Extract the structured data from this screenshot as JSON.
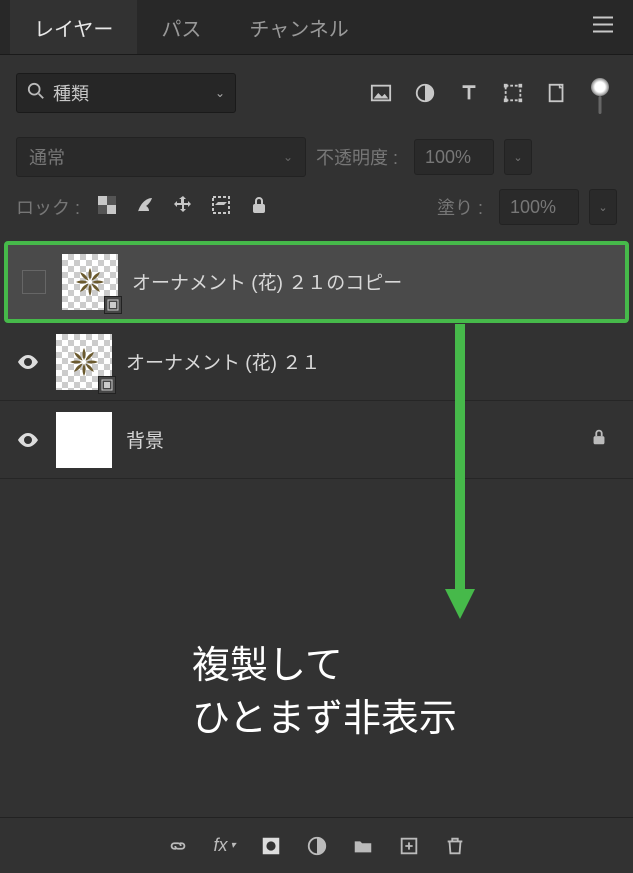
{
  "tabs": {
    "layers": "レイヤー",
    "paths": "パス",
    "channels": "チャンネル"
  },
  "filter": {
    "placeholder": "種類"
  },
  "blend": {
    "mode": "通常",
    "opacity_label": "不透明度 :",
    "opacity_value": "100%"
  },
  "lock": {
    "label": "ロック :",
    "fill_label": "塗り :",
    "fill_value": "100%"
  },
  "layers": [
    {
      "name": "オーナメント (花) ２１のコピー",
      "visible": false,
      "selected": true,
      "type": "smart",
      "locked": false
    },
    {
      "name": "オーナメント (花) ２１",
      "visible": true,
      "selected": false,
      "type": "smart",
      "locked": false
    },
    {
      "name": "背景",
      "visible": true,
      "selected": false,
      "type": "background",
      "locked": true
    }
  ],
  "annotation": {
    "line1": "複製して",
    "line2": "ひとまず非表示"
  }
}
